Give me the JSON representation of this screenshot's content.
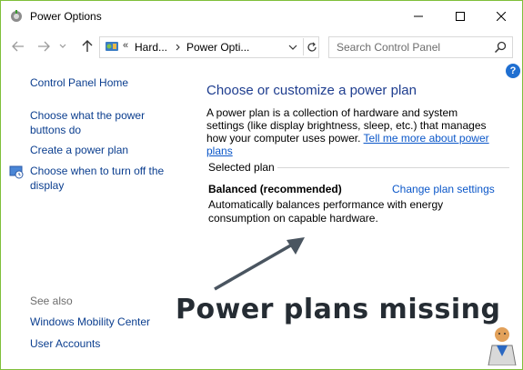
{
  "window": {
    "title": "Power Options"
  },
  "address": {
    "crumbs": [
      "«",
      "Hard...",
      "Power Opti..."
    ],
    "search_placeholder": "Search Control Panel"
  },
  "sidebar": {
    "items": [
      {
        "label": "Control Panel Home"
      },
      {
        "label": "Choose what the power buttons do"
      },
      {
        "label": "Create a power plan"
      },
      {
        "label": "Choose when to turn off the display"
      }
    ],
    "see_also_label": "See also",
    "see_also": [
      {
        "label": "Windows Mobility Center"
      },
      {
        "label": "User Accounts"
      }
    ]
  },
  "main": {
    "title": "Choose or customize a power plan",
    "description": "A power plan is a collection of hardware and system settings (like display brightness, sleep, etc.) that manages how your computer uses power.",
    "description_link": "Tell me more about power plans",
    "selected_plan_label": "Selected plan",
    "plan_name": "Balanced (recommended)",
    "plan_change_link": "Change plan settings",
    "plan_description": "Automatically balances performance with energy consumption on capable hardware."
  },
  "annotation": {
    "text": "Power plans missing"
  },
  "colors": {
    "accent_border": "#7fbf3a",
    "link": "#0b3e8f",
    "title_blue": "#1e3d8f"
  }
}
